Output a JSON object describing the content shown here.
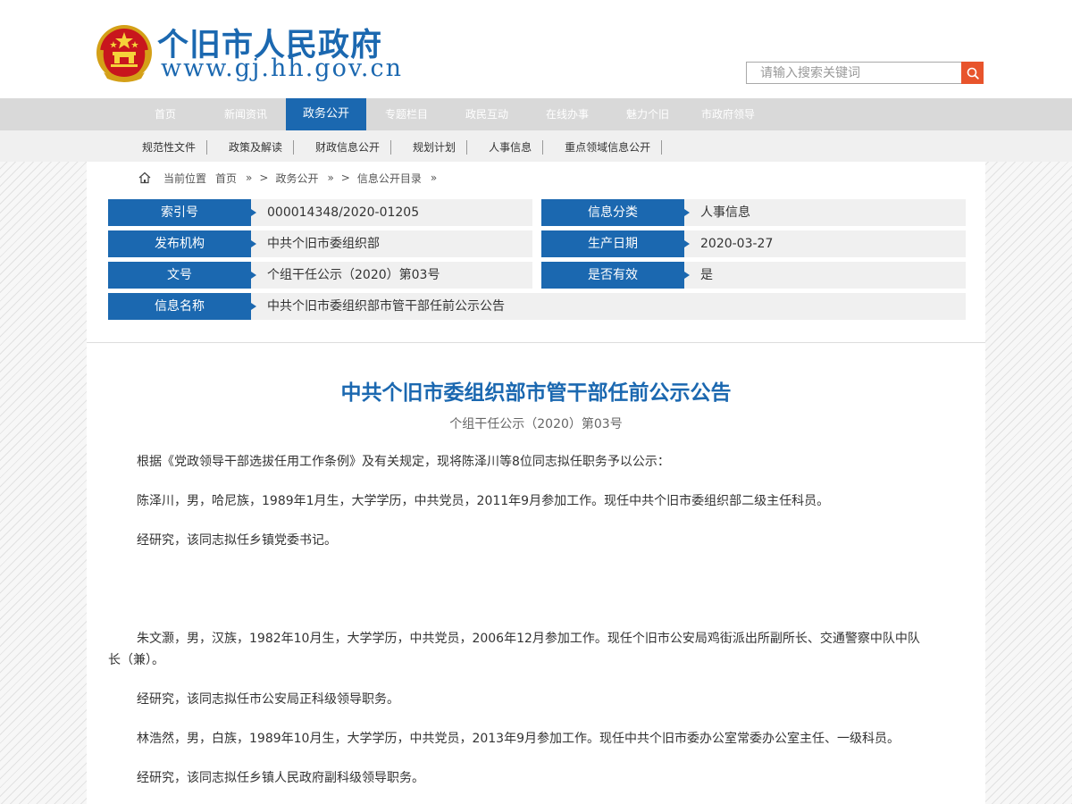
{
  "header": {
    "site_title": "个旧市人民政府",
    "site_url": "www.gj.hh.gov.cn",
    "search_placeholder": "请输入搜索关键词",
    "brand_color": "#1b68b0",
    "search_button_color": "#e8542c",
    "emblem_icon": "national-emblem-icon",
    "search_icon": "search-icon"
  },
  "nav_main": {
    "items": [
      "首页",
      "新闻资讯",
      "政务公开",
      "专题栏目",
      "政民互动",
      "在线办事",
      "魅力个旧",
      "市政府领导"
    ],
    "active": "政务公开"
  },
  "nav_sub": {
    "items": [
      "规范性文件",
      "政策及解读",
      "财政信息公开",
      "规划计划",
      "人事信息",
      "重点领域信息公开"
    ]
  },
  "breadcrumb": {
    "home_icon": "home-icon",
    "label": "当前位置",
    "items": [
      "首页",
      "政务公开",
      "信息公开目录"
    ],
    "separator": "»"
  },
  "meta": {
    "index_no_label": "索引号",
    "index_no_value": "000014348/2020-01205",
    "category_label": "信息分类",
    "category_value": "人事信息",
    "publisher_label": "发布机构",
    "publisher_value": "中共个旧市委组织部",
    "date_label": "生产日期",
    "date_value": "2020-03-27",
    "doc_no_label": "文号",
    "doc_no_value": "个组干任公示（2020）第03号",
    "valid_label": "是否有效",
    "valid_value": "是",
    "name_label": "信息名称",
    "name_value": "中共个旧市委组织部市管干部任前公示公告"
  },
  "article": {
    "title": "中共个旧市委组织部市管干部任前公示公告",
    "subtitle": "个组干任公示（2020）第03号",
    "paragraphs": [
      "根据《党政领导干部选拔任用工作条例》及有关规定，现将陈泽川等8位同志拟任职务予以公示：",
      "陈泽川，男，哈尼族，1989年1月生，大学学历，中共党员，2011年9月参加工作。现任中共个旧市委组织部二级主任科员。",
      "经研究，该同志拟任乡镇党委书记。",
      "朱文灏，男，汉族，1982年10月生，大学学历，中共党员，2006年12月参加工作。现任个旧市公安局鸡街派出所副所长、交通警察中队中队长（兼）。",
      "经研究，该同志拟任市公安局正科级领导职务。",
      "林浩然，男，白族，1989年10月生，大学学历，中共党员，2013年9月参加工作。现任中共个旧市委办公室常委办公室主任、一级科员。",
      "经研究，该同志拟任乡镇人民政府副科级领导职务。"
    ]
  }
}
